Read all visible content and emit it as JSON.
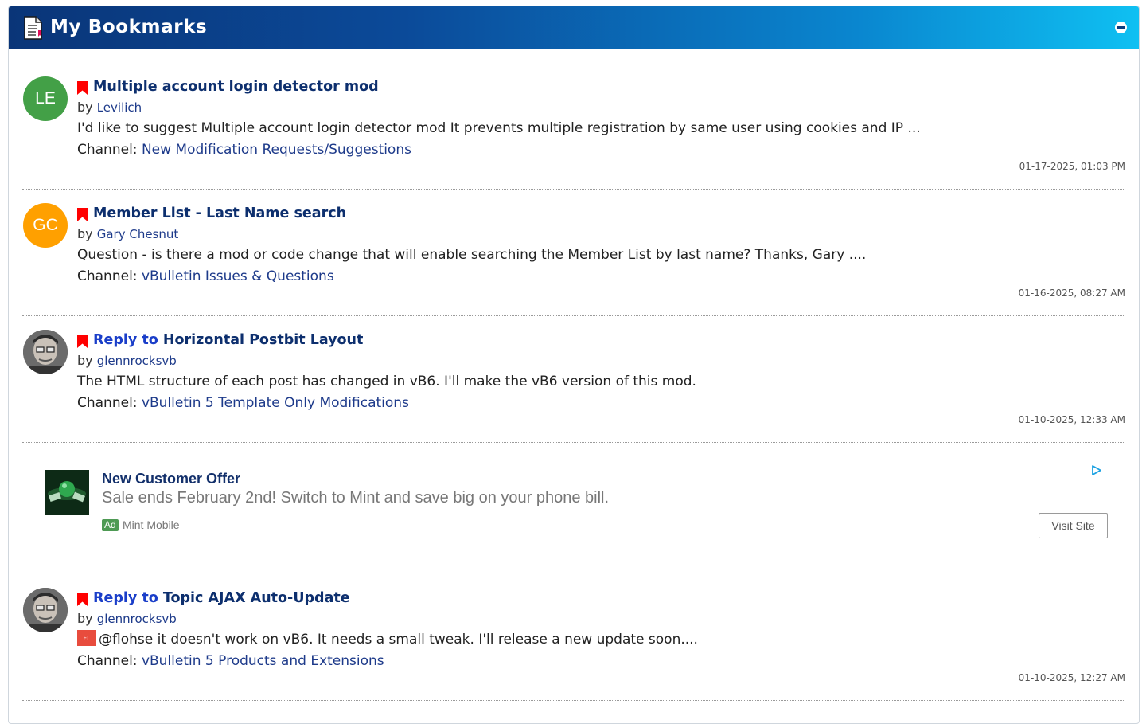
{
  "header": {
    "title": "My Bookmarks",
    "icon": "document-bookmark-icon"
  },
  "colors": {
    "header_start": "#0a3578",
    "header_end": "#0fc0f2",
    "bookmark": "#ff0000",
    "link": "#1d3a8a"
  },
  "bookmarks": [
    {
      "avatar_text": "LE",
      "avatar_color": "#43a047",
      "title_prefix": "",
      "title": "Multiple account login detector mod",
      "by_label": "by",
      "author": "Levilich",
      "excerpt": "I'd like to suggest Multiple account login detector mod It prevents multiple registration by same user using cookies and IP ...",
      "channel_label": "Channel:",
      "channel": "New Modification Requests/Suggestions",
      "date": "01-17-2025, 01:03 PM"
    },
    {
      "avatar_text": "GC",
      "avatar_color": "#ffa000",
      "title_prefix": "",
      "title": "Member List - Last Name search",
      "by_label": "by",
      "author": "Gary Chesnut",
      "excerpt": "Question - is there a mod or code change that will enable searching the Member List by last name? Thanks, Gary ....",
      "channel_label": "Channel:",
      "channel": "vBulletin Issues & Questions",
      "date": "01-16-2025, 08:27 AM"
    },
    {
      "avatar_text": "",
      "avatar_color": "#555555",
      "title_prefix": "Reply to",
      "title": "Horizontal Postbit Layout",
      "by_label": "by",
      "author": "glennrocksvb",
      "excerpt": "The HTML structure of each post has changed in vB6. I'll make the vB6 version of this mod.",
      "channel_label": "Channel:",
      "channel": "vBulletin 5 Template Only Modifications",
      "date": "01-10-2025, 12:33 AM"
    },
    {
      "avatar_text": "",
      "avatar_color": "#555555",
      "title_prefix": "Reply to",
      "title": "Topic AJAX Auto-Update",
      "by_label": "by",
      "author": "glennrocksvb",
      "excerpt_badge": "FL",
      "excerpt": "@flohse it doesn't work on vB6. It needs a small tweak. I'll release a new update soon....",
      "channel_label": "Channel:",
      "channel": "vBulletin 5 Products and Extensions",
      "date": "01-10-2025, 12:27 AM"
    }
  ],
  "ad": {
    "title": "New Customer Offer",
    "description": "Sale ends February 2nd! Switch to Mint and save big on your phone bill.",
    "badge": "Ad",
    "advertiser": "Mint Mobile",
    "cta": "Visit Site"
  }
}
